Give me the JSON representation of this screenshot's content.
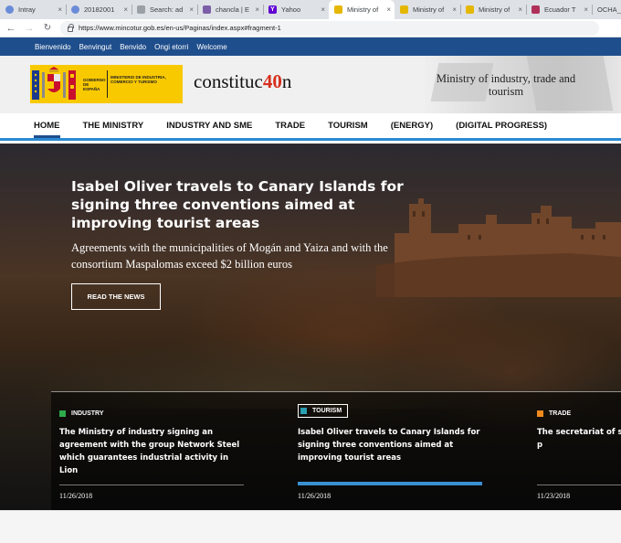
{
  "browser": {
    "tabs": [
      {
        "label": "Intray",
        "icon": "globe-icon",
        "color": "#6a8bd8",
        "active": false
      },
      {
        "label": "20182001",
        "icon": "globe-icon",
        "color": "#6a8bd8",
        "active": false
      },
      {
        "label": "Search: ad",
        "icon": "document-icon",
        "color": "#9aa0a6",
        "active": false
      },
      {
        "label": "chancla | E",
        "icon": "dictionary-icon",
        "color": "#7b5ea7",
        "active": false
      },
      {
        "label": "Yahoo",
        "icon": "yahoo-icon",
        "color": "#5f01d1",
        "active": false
      },
      {
        "label": "Ministry of",
        "icon": "ministry-icon",
        "color": "#e5b700",
        "active": true
      },
      {
        "label": "Ministry of",
        "icon": "ministry-icon",
        "color": "#e5b700",
        "active": false
      },
      {
        "label": "Ministry of",
        "icon": "ministry-icon",
        "color": "#e5b700",
        "active": false
      },
      {
        "label": "Ecuador T",
        "icon": "ecuador-icon",
        "color": "#b0305a",
        "active": false
      },
      {
        "label": "OCHA_",
        "icon": "",
        "color": "",
        "active": false
      }
    ],
    "url": "https://www.mincotur.gob.es/en-us/Paginas/index.aspx#fragment-1"
  },
  "bookmarks": [
    "Bienvenido",
    "Benvingut",
    "Benvido",
    "Ongi etorri",
    "Welcome"
  ],
  "header": {
    "gov_label": "GOBIERNO DE ESPAÑA",
    "ministry_label": "MINISTERIO DE INDUSTRIA, COMERCIO Y TURISMO",
    "constitucion_prefix": "constituc",
    "constitucion_number": "40",
    "constitucion_suffix": "n",
    "ministry_title": "Ministry of industry, trade and tourism"
  },
  "nav": [
    "HOME",
    "THE MINISTRY",
    "INDUSTRY AND SME",
    "TRADE",
    "TOURISM",
    "(ENERGY)",
    "(DIGITAL PROGRESS)"
  ],
  "hero": {
    "title": "Isabel Oliver travels to Canary Islands for signing three conventions aimed at improving tourist areas",
    "subtitle": "Agreements with the municipalities of Mogán and Yaiza and with the consortium Maspalomas exceed $2 billion euros",
    "button": "READ THE NEWS"
  },
  "news": [
    {
      "category": "INDUSTRY",
      "color": "#2eaa4a",
      "title": "The Ministry of industry signing an agreement with the group Network Steel which guarantees industrial activity in Lion",
      "date": "11/26/2018",
      "active": false
    },
    {
      "category": "TOURISM",
      "color": "#2a9fb0",
      "title": "Isabel Oliver travels to Canary Islands for signing three conventions aimed at improving tourist areas",
      "date": "11/26/2018",
      "active": true
    },
    {
      "category": "TRADE",
      "color": "#f08a1c",
      "title": "The secretariat of sta Spanish companies p",
      "date": "11/23/2018",
      "active": false
    }
  ]
}
